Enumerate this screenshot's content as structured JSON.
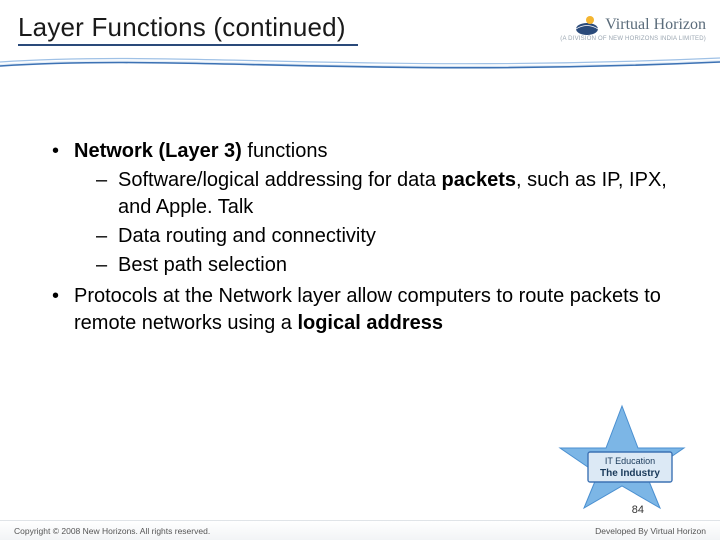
{
  "header": {
    "title": "Layer Functions (continued)",
    "brand_name": "Virtual Horizon",
    "brand_sub": "(A DIVISION OF NEW HORIZONS INDIA LIMITED)"
  },
  "content": {
    "b1_bold": "Network (Layer 3)",
    "b1_rest": " functions",
    "b1s1_pre": "Software/logical addressing for data ",
    "b1s1_bold": "packets",
    "b1s1_post": ", such as IP, IPX, and Apple. Talk",
    "b1s2": "Data routing and connectivity",
    "b1s3": "Best path selection",
    "b2_pre": "Protocols at the Network layer allow computers to route packets to remote networks using a ",
    "b2_bold": "logical address"
  },
  "badge": {
    "line1": "IT Education",
    "line2": "The Industry",
    "line3": ""
  },
  "footer": {
    "left": "Copyright © 2008 New Horizons. All rights reserved.",
    "right": "Developed By Virtual Horizon",
    "page": "84"
  }
}
